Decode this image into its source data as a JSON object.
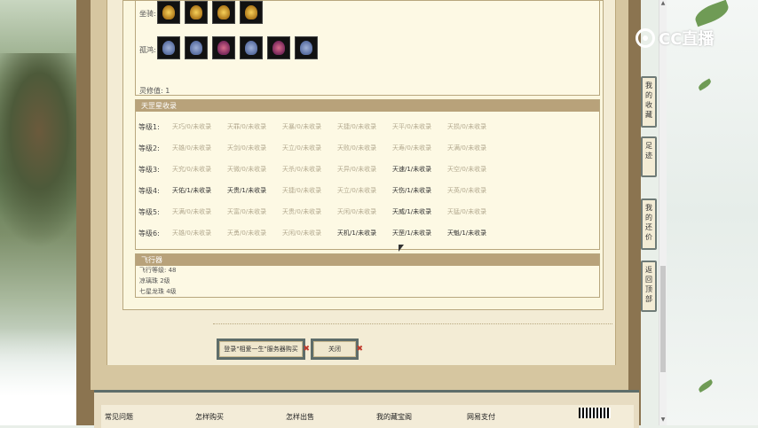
{
  "top_section": {
    "zuoqi_label": "坐骑:",
    "guanghui_label": "孤鸿:",
    "lingxiu_label": "灵修值:",
    "lingxiu_value": "1"
  },
  "rank_section": {
    "header": "天罡星收录",
    "rows": [
      {
        "level": "等级1:",
        "cells": [
          {
            "text": "天巧/0/未收录",
            "on": false
          },
          {
            "text": "天罪/0/未收录",
            "on": false
          },
          {
            "text": "天暴/0/未收录",
            "on": false
          },
          {
            "text": "天捷/0/未收录",
            "on": false
          },
          {
            "text": "天平/0/未收录",
            "on": false
          },
          {
            "text": "天损/0/未收录",
            "on": false
          }
        ]
      },
      {
        "level": "等级2:",
        "cells": [
          {
            "text": "天雄/0/未收录",
            "on": false
          },
          {
            "text": "天剑/0/未收录",
            "on": false
          },
          {
            "text": "天立/0/未收录",
            "on": false
          },
          {
            "text": "天败/0/未收录",
            "on": false
          },
          {
            "text": "天寿/0/未收录",
            "on": false
          },
          {
            "text": "天满/0/未收录",
            "on": false
          }
        ]
      },
      {
        "level": "等级3:",
        "cells": [
          {
            "text": "天究/0/未收录",
            "on": false
          },
          {
            "text": "天微/0/未收录",
            "on": false
          },
          {
            "text": "天杀/0/未收录",
            "on": false
          },
          {
            "text": "天异/0/未收录",
            "on": false
          },
          {
            "text": "天速/1/未收录",
            "on": true
          },
          {
            "text": "天空/0/未收录",
            "on": false
          }
        ]
      },
      {
        "level": "等级4:",
        "cells": [
          {
            "text": "天佑/1/未收录",
            "on": true
          },
          {
            "text": "天贵/1/未收录",
            "on": true
          },
          {
            "text": "天捷/0/未收录",
            "on": false
          },
          {
            "text": "天立/0/未收录",
            "on": false
          },
          {
            "text": "天伤/1/未收录",
            "on": true
          },
          {
            "text": "天英/0/未收录",
            "on": false
          }
        ]
      },
      {
        "level": "等级5:",
        "cells": [
          {
            "text": "天满/0/未收录",
            "on": false
          },
          {
            "text": "天富/0/未收录",
            "on": false
          },
          {
            "text": "天贵/0/未收录",
            "on": false
          },
          {
            "text": "天闲/0/未收录",
            "on": false
          },
          {
            "text": "天威/1/未收录",
            "on": true
          },
          {
            "text": "天猛/0/未收录",
            "on": false
          }
        ]
      },
      {
        "level": "等级6:",
        "cells": [
          {
            "text": "天雄/0/未收录",
            "on": false
          },
          {
            "text": "天勇/0/未收录",
            "on": false
          },
          {
            "text": "天闲/0/未收录",
            "on": false
          },
          {
            "text": "天机/1/未收录",
            "on": true
          },
          {
            "text": "天罡/1/未收录",
            "on": true
          },
          {
            "text": "天魁/1/未收录",
            "on": true
          }
        ]
      }
    ]
  },
  "fly_section": {
    "header": "飞行器",
    "lines": [
      "飞行等级: 48",
      "凉璃珠 2级",
      "七星龙珠 4级"
    ]
  },
  "buttons": {
    "login_label": "登录\"相爱一生\"服务器购买",
    "close_label": "关闭"
  },
  "footer": {
    "links": [
      "常见问题",
      "怎样购买",
      "怎样出售",
      "我的藏宝阁",
      "网易支付"
    ]
  },
  "sidebar": {
    "items": [
      "我的收藏",
      "足迹",
      "我的还价",
      "返回顶部"
    ]
  },
  "watermark": {
    "text": "CC直播"
  }
}
